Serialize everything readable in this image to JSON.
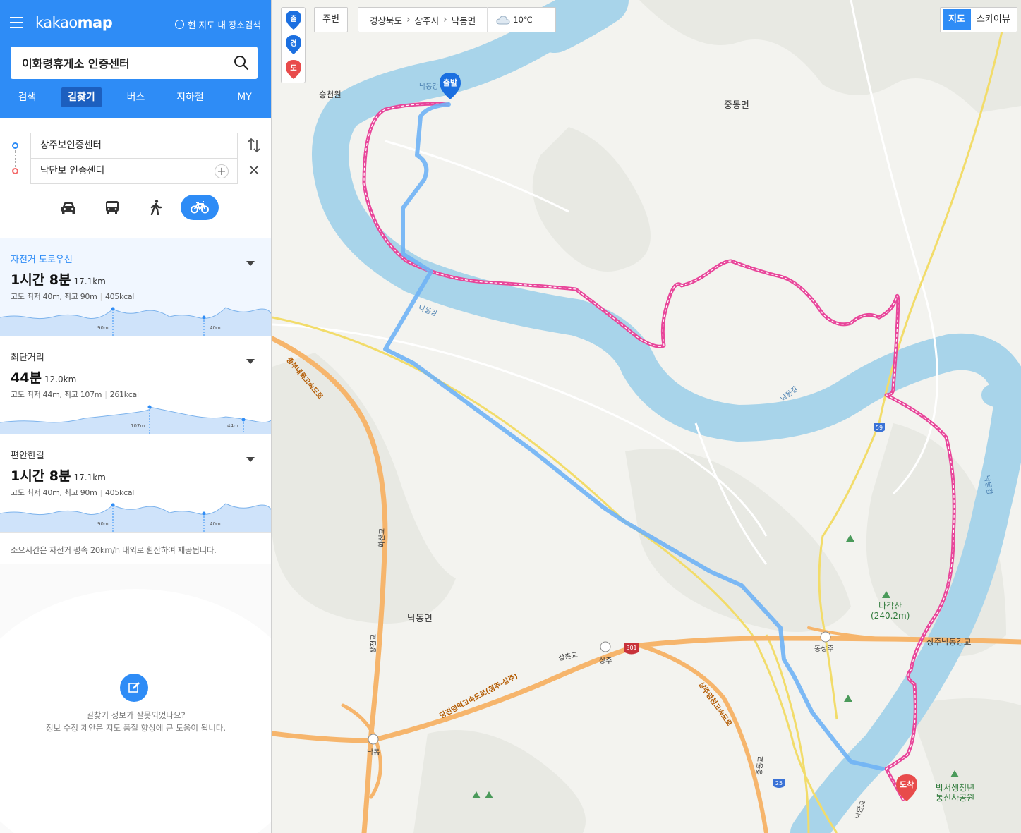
{
  "app": {
    "logo_light": "kakao",
    "logo_bold": "map",
    "nearby_search_label": "현 지도 내 장소검색"
  },
  "search": {
    "value": "이화령휴게소 인증센터"
  },
  "tabs": [
    "검색",
    "길찾기",
    "버스",
    "지하철",
    "MY"
  ],
  "active_tab": "길찾기",
  "route": {
    "origin": "상주보인증센터",
    "destination": "낙단보 인증센터"
  },
  "transport_modes": [
    "car-icon",
    "bus-icon",
    "walk-icon",
    "bicycle-icon"
  ],
  "active_mode": "bicycle-icon",
  "routes": [
    {
      "name": "자전거 도로우선",
      "time": "1시간 8분",
      "distance": "17.1km",
      "elevation": "고도 최저 40m, 최고 90m",
      "kcal": "405kcal",
      "profile_labels": [
        "90m",
        "40m"
      ],
      "selected": true
    },
    {
      "name": "최단거리",
      "time": "44분",
      "distance": "12.0km",
      "elevation": "고도 최저 44m, 최고 107m",
      "kcal": "261kcal",
      "profile_labels": [
        "107m",
        "44m"
      ],
      "selected": false
    },
    {
      "name": "편안한길",
      "time": "1시간 8분",
      "distance": "17.1km",
      "elevation": "고도 최저 40m, 최고 90m",
      "kcal": "405kcal",
      "profile_labels": [
        "90m",
        "40m"
      ],
      "selected": false
    }
  ],
  "time_note": "소요시간은 자전거 평속 20km/h 내외로 환산하여 제공됩니다.",
  "feedback": {
    "line1": "길찾기 정보가 잘못되었나요?",
    "line2": "정보 수정 제안은 지도 품질 향상에 큰 도움이 됩니다."
  },
  "map_controls": {
    "markers": [
      "출",
      "경",
      "도"
    ],
    "nearby": "주변",
    "breadcrumb": [
      "경상북도",
      "상주시",
      "낙동면"
    ],
    "weather": "10℃",
    "view_map": "지도",
    "view_sky": "스카이뷰"
  },
  "map_labels": {
    "start": "출발",
    "end": "도착",
    "places": [
      "승천원",
      "중동면",
      "낙동면",
      "나각산",
      "(240.2m)",
      "박서생청년",
      "통신사공원",
      "상주낙동강교",
      "동상주",
      "상주",
      "낙동",
      "상촌교"
    ],
    "rivers": [
      "낙동강",
      "낙동강",
      "낙동강",
      "낙동강"
    ],
    "roads": [
      "중부내륙고속도로",
      "당진영덕고속도로(청주-상주)",
      "상주영천고속도로",
      "화산교",
      "장천교",
      "중동교",
      "낙단교"
    ],
    "route_numbers": [
      "59",
      "301",
      "25"
    ]
  },
  "colors": {
    "brand": "#2e8cf6",
    "route_pink": "#e8469a",
    "route_blue": "#6fb2f5",
    "river": "#a8d4ea",
    "highway": "#f6b56c"
  }
}
